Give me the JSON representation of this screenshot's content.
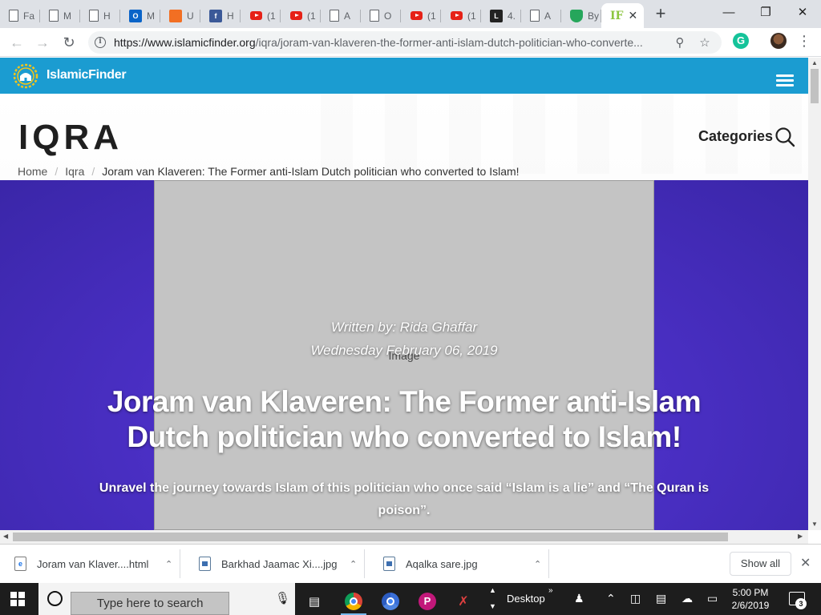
{
  "browser": {
    "tabs": [
      {
        "title": "Fa",
        "icon": "document-icon"
      },
      {
        "title": "M",
        "icon": "document-icon"
      },
      {
        "title": "H",
        "icon": "document-icon"
      },
      {
        "title": "M",
        "icon": "outlook-icon"
      },
      {
        "title": "U",
        "icon": "soundcloud-icon"
      },
      {
        "title": "H",
        "icon": "facebook-icon"
      },
      {
        "title": "(1",
        "icon": "youtube-icon"
      },
      {
        "title": "(1",
        "icon": "youtube-icon"
      },
      {
        "title": "A",
        "icon": "document-icon"
      },
      {
        "title": "O",
        "icon": "document-icon"
      },
      {
        "title": "(1",
        "icon": "youtube-icon"
      },
      {
        "title": "(1",
        "icon": "youtube-icon"
      },
      {
        "title": "4.",
        "icon": "black-l-icon"
      },
      {
        "title": "A",
        "icon": "document-icon"
      },
      {
        "title": "By",
        "icon": "shield-icon"
      },
      {
        "title": "IF",
        "icon": "islamicfinder-icon",
        "active": true
      }
    ],
    "url_host": "https://www.islamicfinder.org",
    "url_path": "/iqra/joram-van-klaveren-the-former-anti-islam-dutch-politician-who-converte..."
  },
  "site": {
    "logo_text": "IslamicFinder",
    "section_title": "IQRA",
    "categories_label": "Categories",
    "brand_color": "#1b9cd1"
  },
  "breadcrumb": {
    "home": "Home",
    "section": "Iqra",
    "current": "Joram van Klaveren: The Former anti-Islam Dutch politician who converted to Islam!"
  },
  "article": {
    "byline": "Written by: Rida Ghaffar",
    "date": "Wednesday February 06, 2019",
    "headline": "Joram van Klaveren: The Former anti-Islam Dutch politician who converted to Islam!",
    "subtitle": "Unravel the journey towards Islam of this politician who once said “Islam is a lie” and “The Quran is poison”."
  },
  "downloads": {
    "items": [
      {
        "name": "Joram van Klaver....html"
      },
      {
        "name": "Barkhad Jaamac Xi....jpg"
      },
      {
        "name": "Aqalka sare.jpg"
      }
    ],
    "show_all": "Show all"
  },
  "taskbar": {
    "search_placeholder": "Type here to search",
    "desktop_label": "Desktop",
    "time": "5:00 PM",
    "date": "2/6/2019",
    "notification_count": "3"
  }
}
